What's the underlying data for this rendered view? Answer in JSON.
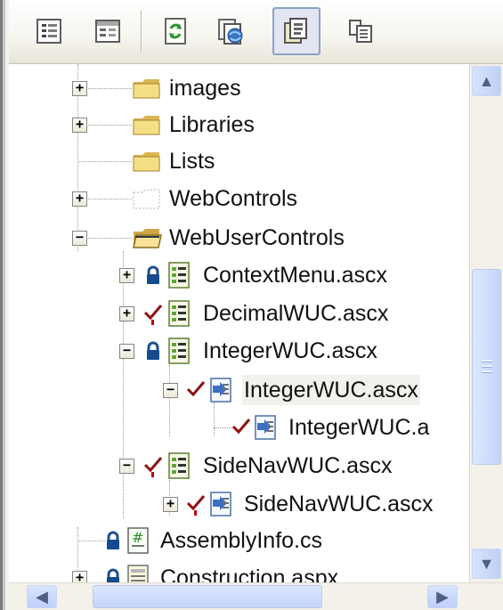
{
  "toolbar": {
    "buttons": [
      {
        "name": "properties",
        "icon": "properties-icon"
      },
      {
        "name": "view-code",
        "icon": "code-view-icon"
      },
      {
        "name": "refresh",
        "icon": "refresh-icon"
      },
      {
        "name": "copy-website",
        "icon": "copy-website-icon"
      },
      {
        "name": "show-all-files",
        "icon": "show-all-files-icon",
        "active": true
      },
      {
        "name": "nest-related-files",
        "icon": "nest-files-icon"
      }
    ]
  },
  "tree": {
    "items": [
      {
        "label": "images",
        "icon": "folder-icon"
      },
      {
        "label": "Libraries",
        "icon": "folder-icon"
      },
      {
        "label": "Lists",
        "icon": "folder-icon"
      },
      {
        "label": "WebControls",
        "icon": "folder-outline-icon"
      },
      {
        "label": "WebUserControls",
        "icon": "folder-open-icon"
      },
      {
        "label": "ContextMenu.ascx",
        "icon": "ascx-file-icon"
      },
      {
        "label": "DecimalWUC.ascx",
        "icon": "ascx-file-icon"
      },
      {
        "label": "IntegerWUC.ascx",
        "icon": "ascx-file-icon"
      },
      {
        "label": "IntegerWUC.ascx",
        "icon": "code-file-icon"
      },
      {
        "label": "IntegerWUC.a",
        "icon": "code-file-icon"
      },
      {
        "label": "SideNavWUC.ascx",
        "icon": "ascx-file-icon"
      },
      {
        "label": "SideNavWUC.ascx",
        "icon": "code-file-icon"
      },
      {
        "label": "AssemblyInfo.cs",
        "icon": "csharp-file-icon"
      },
      {
        "label": "Construction.aspx",
        "icon": "aspx-file-icon"
      }
    ]
  },
  "scrollbars": {
    "vertical_position": 0.42,
    "horizontal_position": 0.0
  }
}
